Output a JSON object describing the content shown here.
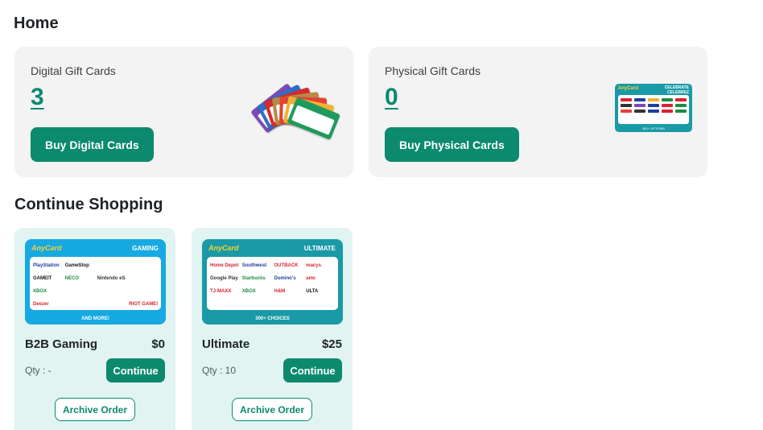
{
  "page": {
    "title": "Home"
  },
  "summary": {
    "digital": {
      "label": "Digital Gift Cards",
      "count": "3",
      "button_label": "Buy Digital Cards"
    },
    "physical": {
      "label": "Physical Gift Cards",
      "count": "0",
      "button_label": "Buy Physical Cards",
      "card_brand": "AnyCard",
      "card_tag": "CELEBRATE",
      "card_tag2": "CELEBREZ",
      "card_footer": "300+ OPTIONS"
    }
  },
  "continue_shopping": {
    "title": "Continue Shopping",
    "qty_prefix": "Qty : ",
    "continue_label": "Continue",
    "archive_label": "Archive Order",
    "orders": [
      {
        "name": "B2B Gaming",
        "price": "$0",
        "qty": "Qty : -",
        "image": {
          "brand": "AnyCard",
          "tag": "GAMING",
          "footer": "AND MORE!",
          "logos": [
            "PlayStation",
            "GameStop",
            "",
            "",
            "GAMEIT",
            "NECO",
            "Nintendo eShop",
            "",
            "XBOX",
            "",
            "",
            "",
            "Deezer",
            "",
            "",
            "RIOT GAMES"
          ]
        }
      },
      {
        "name": "Ultimate",
        "price": "$25",
        "qty": "Qty : 10",
        "image": {
          "brand": "AnyCard",
          "tag": "ULTIMATE",
          "footer": "300+ CHOICES",
          "logos": [
            "Home Depot",
            "Southwest",
            "OUTBACK",
            "macys",
            "Google Play",
            "Starbucks",
            "Domino's",
            "amc",
            "TJ·MAXX",
            "XBOX",
            "H&M",
            "ULTA"
          ]
        }
      }
    ]
  },
  "colors": {
    "accent": "#0b8a6e",
    "card_bg": "#f3f3f3",
    "order_bg": "#e1f4f1",
    "gaming_blue": "#17a9e1",
    "ultimate_teal": "#1a9aa6",
    "brand_yellow": "#f6d233"
  }
}
